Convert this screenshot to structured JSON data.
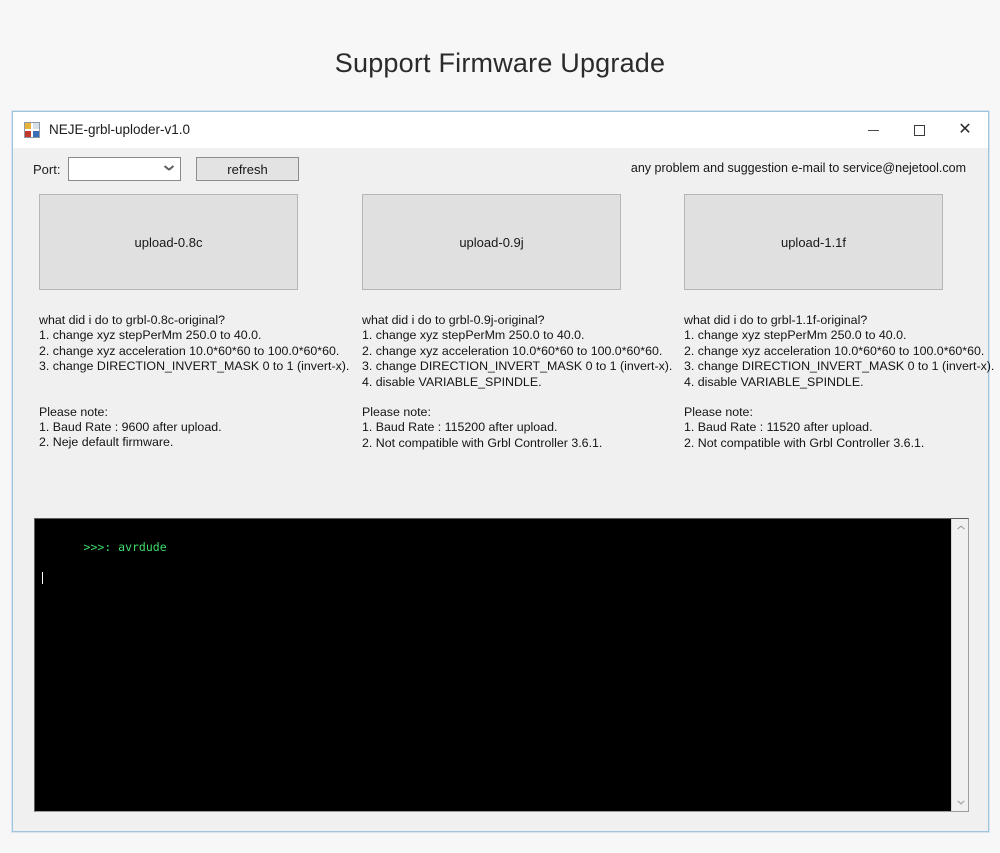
{
  "page": {
    "heading": "Support Firmware Upgrade",
    "background_color": "#f7f7f7"
  },
  "window": {
    "title": "NEJE-grbl-uploder-v1.0",
    "icon": "app-grid-icon",
    "border_color": "#9ec5e0",
    "controls": {
      "minimize": "minimize-icon",
      "maximize": "maximize-icon",
      "close": "close-icon"
    }
  },
  "toolbar": {
    "port_label": "Port:",
    "port_value": "",
    "port_placeholder": "",
    "refresh_label": "refresh",
    "contact_note": "any problem and suggestion e-mail to service@nejetool.com"
  },
  "columns": [
    {
      "button_label": "upload-0.8c",
      "question": "what did i do to grbl-0.8c-original?",
      "changes": [
        "1. change xyz stepPerMm 250.0 to 40.0.",
        "2. change xyz acceleration 10.0*60*60 to 100.0*60*60.",
        "3. change DIRECTION_INVERT_MASK 0 to 1 (invert-x)."
      ],
      "note_heading": "Please note:",
      "notes": [
        "1. Baud Rate : 9600 after upload.",
        "2. Neje default firmware."
      ]
    },
    {
      "button_label": "upload-0.9j",
      "question": "what did i do to grbl-0.9j-original?",
      "changes": [
        "1. change xyz stepPerMm 250.0 to 40.0.",
        "2. change xyz acceleration 10.0*60*60 to 100.0*60*60.",
        "3. change DIRECTION_INVERT_MASK 0 to 1 (invert-x).",
        "4. disable VARIABLE_SPINDLE."
      ],
      "note_heading": "Please note:",
      "notes": [
        "1. Baud Rate : 115200 after upload.",
        "2. Not compatible with Grbl Controller 3.6.1."
      ]
    },
    {
      "button_label": "upload-1.1f",
      "question": "what did i do to grbl-1.1f-original?",
      "changes": [
        "1. change xyz stepPerMm 250.0 to 40.0.",
        "2. change xyz acceleration 10.0*60*60 to 100.0*60*60.",
        "3. change DIRECTION_INVERT_MASK 0 to 1 (invert-x).",
        "4. disable VARIABLE_SPINDLE."
      ],
      "note_heading": "Please note:",
      "notes": [
        "1. Baud Rate : 11520 after upload.",
        "2. Not compatible with Grbl Controller 3.6.1."
      ]
    }
  ],
  "console": {
    "text": ">>>: avrdude",
    "text_color": "#3ddc6a",
    "background_color": "#000000",
    "scrollbar": {
      "up": "chevron-up-icon",
      "down": "chevron-down-icon"
    }
  }
}
